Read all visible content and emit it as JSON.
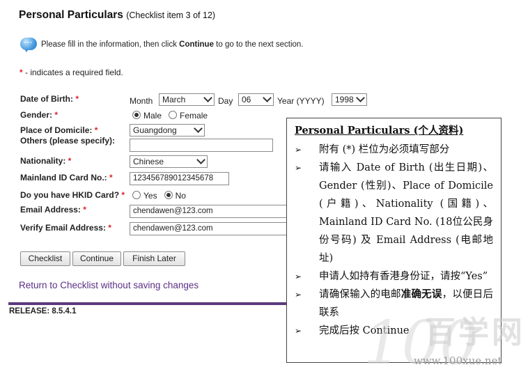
{
  "page": {
    "title": "Personal Particulars",
    "subtitle": "(Checklist item 3 of 12)",
    "info_text_prefix": "Please fill in the information, then click ",
    "info_text_bold": "Continue",
    "info_text_suffix": " to go to the next section.",
    "required_star": "*",
    "required_text": " - indicates a required field."
  },
  "form": {
    "dob_label": "Date of Birth:",
    "month_label": "Month",
    "month_value": "March",
    "day_label": "Day",
    "day_value": "06",
    "year_label": "Year (YYYY)",
    "year_value": "1998",
    "gender_label": "Gender:",
    "gender_male": "Male",
    "gender_female": "Female",
    "domicile_label": "Place of Domicile:",
    "domicile_value": "Guangdong",
    "others_label": "Others (please specify):",
    "others_value": "",
    "nationality_label": "Nationality:",
    "nationality_value": "Chinese",
    "mainland_id_label": "Mainland ID Card No.:",
    "mainland_id_value": "123456789012345678",
    "hkid_label": "Do you have HKID Card?",
    "hkid_yes": "Yes",
    "hkid_no": "No",
    "email_label": "Email Address:",
    "email_value": "chendawen@123.com",
    "verify_email_label": "Verify Email Address:",
    "verify_email_value": "chendawen@123.com"
  },
  "buttons": {
    "checklist": "Checklist",
    "continue": "Continue",
    "finish_later": "Finish Later"
  },
  "footer": {
    "return_link": "Return to Checklist without saving changes",
    "release": "RELEASE: 8.5.4.1"
  },
  "overlay": {
    "heading": "Personal Particulars (个人资料)",
    "items": [
      "附有 (*) 栏位为必须填写部分",
      "请输入 Date of Birth (出生日期)、Gender (性别)、Place of Domicile (户籍)、Nationality (国籍)、Mainland ID Card No. (18位公民身份号码) 及 Email Address (电邮地址)",
      "申请人如持有香港身份证，请按“Yes”",
      "请确保输入的电邮",
      "完成后按 Continue"
    ],
    "item4_bold": "准确无误",
    "item4_suffix": "，以便日后联系"
  },
  "watermark": {
    "number": "100",
    "chars": "百学网",
    "url": "www.100xue.net"
  },
  "colors": {
    "required_star": "#e0202a",
    "link_purple": "#5b2f84",
    "bar_purple": "#5c3a7e"
  }
}
